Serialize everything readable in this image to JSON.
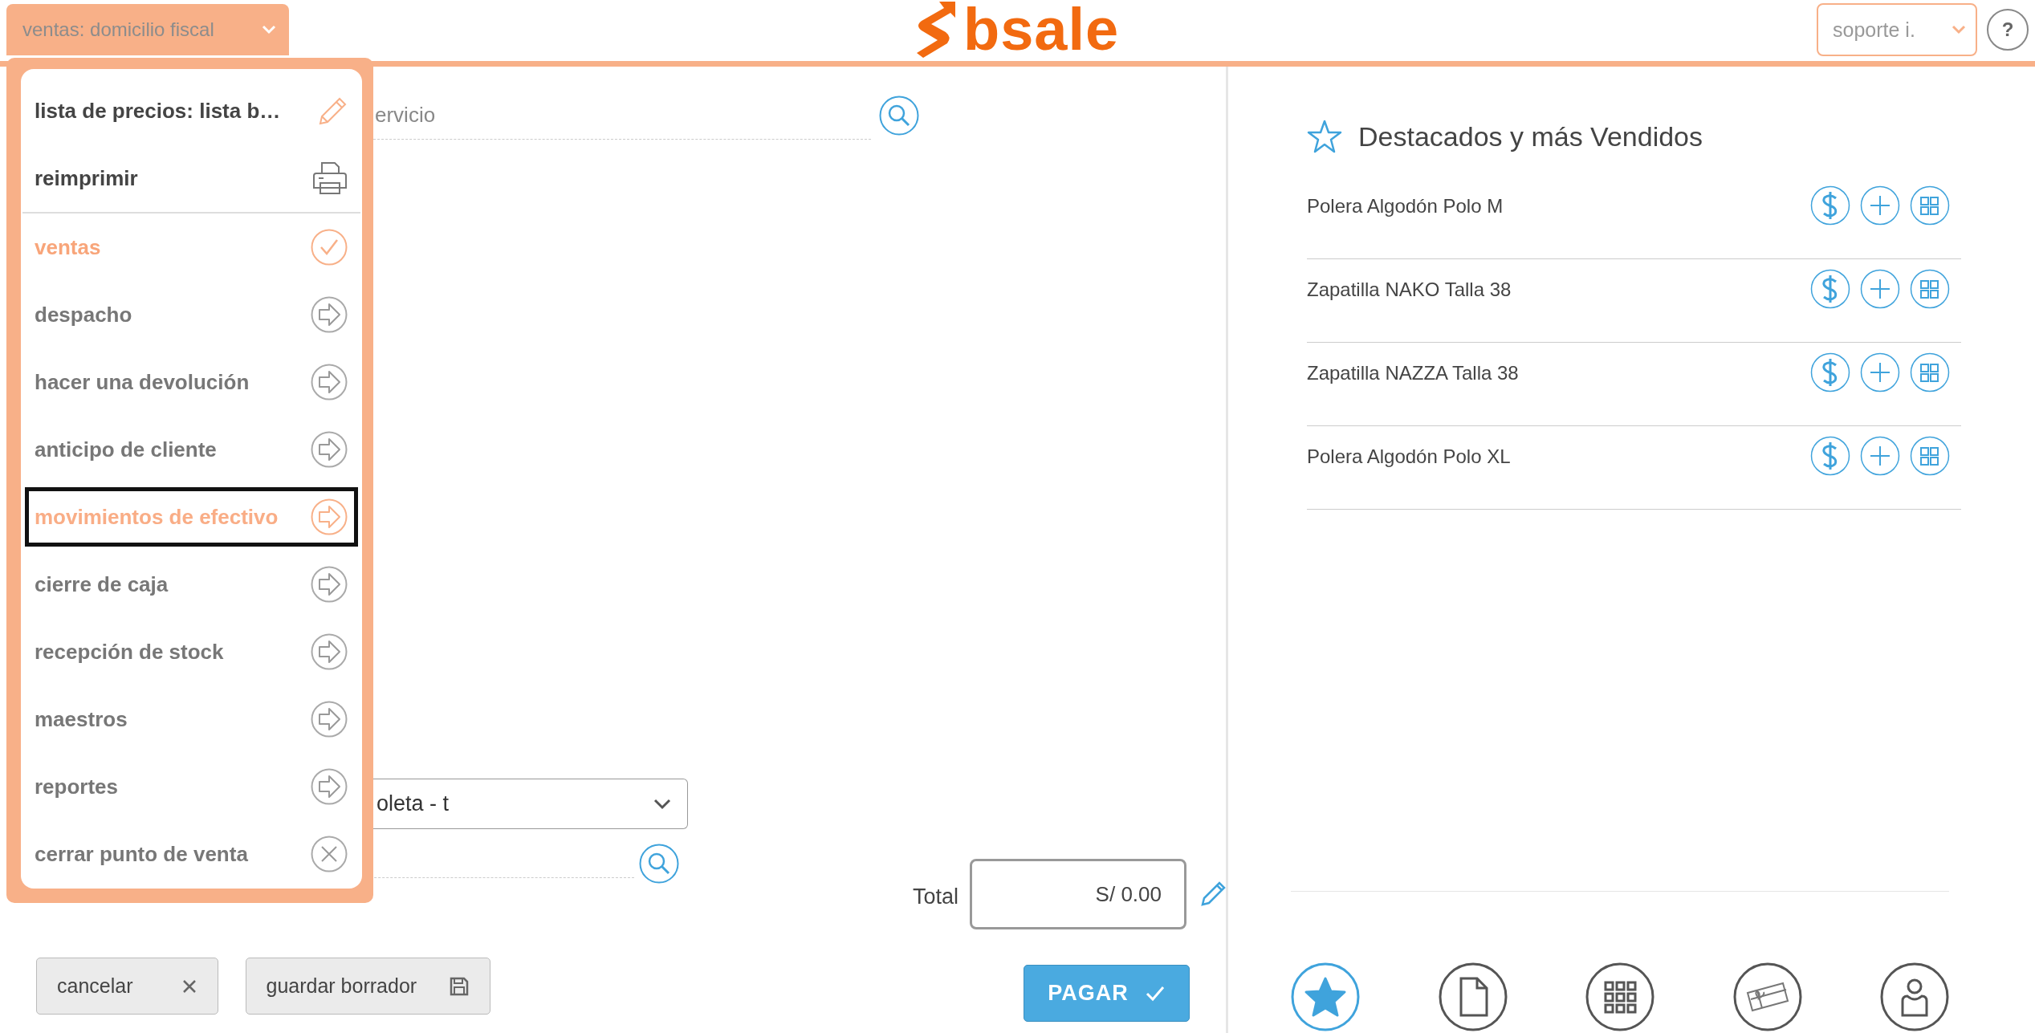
{
  "top_bar": {
    "mode_select": {
      "value": "ventas: domicilio fiscal"
    },
    "logo": "bsale",
    "user_select": {
      "value": "soporte i."
    },
    "help_button": "?"
  },
  "menu": {
    "actions": [
      {
        "label": "lista de precios: lista b…",
        "kind": "edit"
      },
      {
        "label": "reimprimir",
        "kind": "print"
      }
    ],
    "modes": [
      {
        "label": "ventas",
        "kind": "check",
        "selected": true,
        "focused": false
      },
      {
        "label": "despacho",
        "kind": "arrow",
        "selected": false,
        "focused": false
      },
      {
        "label": "hacer una devolución",
        "kind": "arrow",
        "selected": false,
        "focused": false
      },
      {
        "label": "anticipo de cliente",
        "kind": "arrow",
        "selected": false,
        "focused": false
      },
      {
        "label": "movimientos de efectivo",
        "kind": "arrow",
        "selected": false,
        "focused": true
      },
      {
        "label": "cierre de caja",
        "kind": "arrow",
        "selected": false,
        "focused": false
      },
      {
        "label": "recepción de stock",
        "kind": "arrow",
        "selected": false,
        "focused": false
      },
      {
        "label": "maestros",
        "kind": "arrow",
        "selected": false,
        "focused": false
      },
      {
        "label": "reportes",
        "kind": "arrow",
        "selected": false,
        "focused": false
      },
      {
        "label": "cerrar punto de venta",
        "kind": "close",
        "selected": false,
        "focused": false
      }
    ]
  },
  "sale": {
    "search": {
      "placeholder": "ervicio"
    },
    "document_select": {
      "value": "oleta - t"
    },
    "total_label": "Total",
    "total": "S/ 0.00",
    "buttons": [
      {
        "label": "cancelar",
        "kind": "cancel"
      },
      {
        "label": "guardar borrador",
        "kind": "save"
      }
    ],
    "pay_button": "PAGAR"
  },
  "featured": {
    "title": "Destacados y más Vendidos",
    "products": [
      {
        "name": "Polera Algodón Polo M"
      },
      {
        "name": "Zapatilla NAKO Talla 38"
      },
      {
        "name": "Zapatilla NAZZA Talla 38"
      },
      {
        "name": "Polera Algodón Polo XL"
      }
    ]
  },
  "bottom_nav": [
    {
      "kind": "star",
      "selected": true
    },
    {
      "kind": "document",
      "selected": false
    },
    {
      "kind": "grid",
      "selected": false
    },
    {
      "kind": "gift-card",
      "selected": false
    },
    {
      "kind": "user",
      "selected": false
    }
  ]
}
